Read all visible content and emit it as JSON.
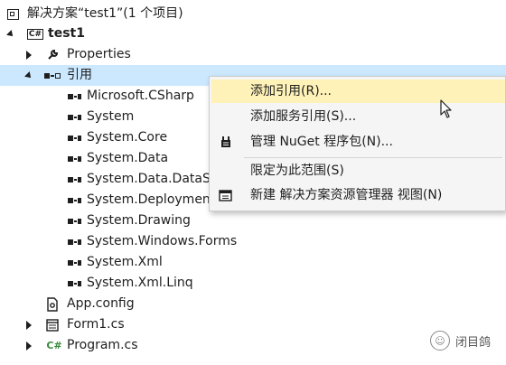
{
  "solution": {
    "label": "解决方案“test1”(1 个项目)"
  },
  "project": {
    "label": "test1",
    "badge": "C#"
  },
  "properties": {
    "label": "Properties"
  },
  "references": {
    "label": "引用",
    "items": [
      "Microsoft.CSharp",
      "System",
      "System.Core",
      "System.Data",
      "System.Data.DataSe",
      "System.Deployment",
      "System.Drawing",
      "System.Windows.Forms",
      "System.Xml",
      "System.Xml.Linq"
    ]
  },
  "files": {
    "app_config": "App.config",
    "form1": "Form1.cs",
    "program": "Program.cs"
  },
  "context_menu": {
    "items": [
      {
        "label": "添加引用(R)...",
        "highlighted": true
      },
      {
        "label": "添加服务引用(S)..."
      },
      {
        "label": "管理 NuGet 程序包(N)...",
        "icon": "nuget-icon"
      },
      {
        "label": "限定为此范围(S)"
      },
      {
        "label": "新建 解决方案资源管理器 视图(N)",
        "icon": "new-view-icon"
      }
    ]
  },
  "watermark": {
    "text": "闭目鸽"
  },
  "colors": {
    "selection": "#cce8ff",
    "menu_highlight": "#fff2b8",
    "menu_bg": "#f5f5f5"
  }
}
